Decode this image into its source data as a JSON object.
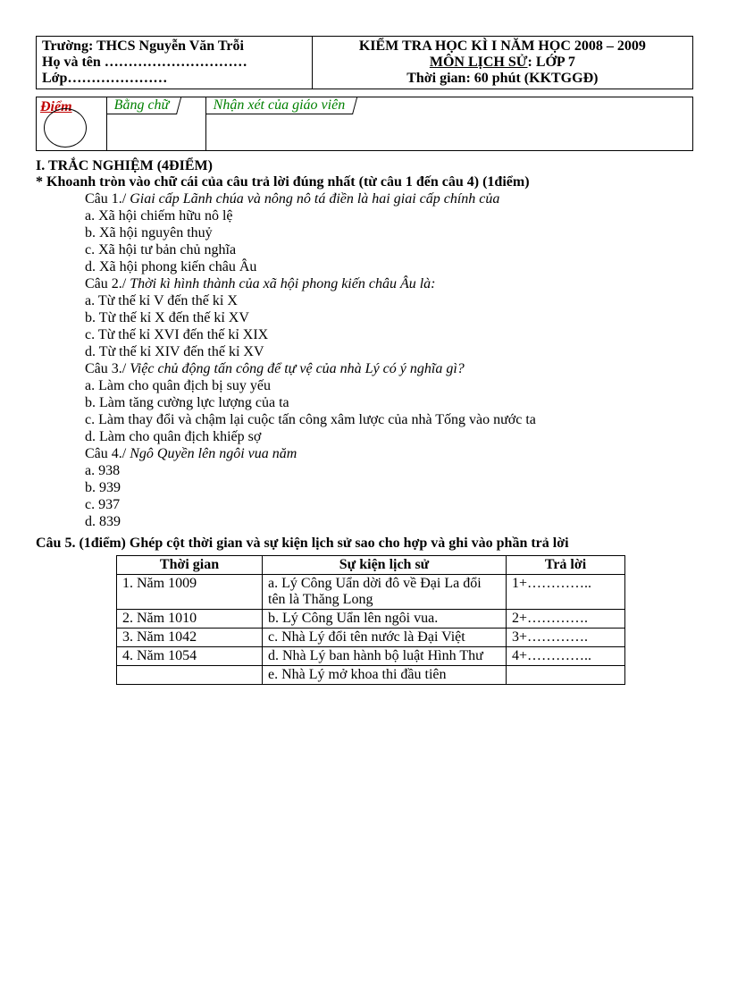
{
  "header": {
    "school": "Trường: THCS Nguyễn Văn Trỗi",
    "name": "Họ và tên …………………………",
    "class": "Lớp…………………",
    "exam_title": "KIỂM TRA HỌC KÌ I NĂM HỌC 2008 – 2009",
    "subject": "MÔN LỊCH SỬ: LỚP 7",
    "subject_label": "MÔN LỊCH SỬ",
    "subject_rest": ": LỚP 7",
    "time": "Thời gian:  60 phút (KKTGGĐ)"
  },
  "grade": {
    "score": "Điểm",
    "words": "Bằng chữ",
    "comment": "Nhận xét của giáo viên"
  },
  "section1": {
    "title": "I. TRẮC NGHIỆM (4ĐIỂM)",
    "instruction": "* Khoanh tròn vào chữ cái của câu trả lời đúng nhất (từ câu 1 đến  câu 4) (1điểm)"
  },
  "q1": {
    "prompt_lead": "Câu 1./ ",
    "prompt": "Giai cấp Lãnh chúa và nông nô tá điền là hai giai cấp chính của",
    "a": "a.   Xã hội chiếm hữu nô lệ",
    "b": "b.   Xã hội nguyên thuỷ",
    "c": "c.   Xã hội tư bản chủ nghĩa",
    "d": "d.   Xã hội phong kiến châu Âu"
  },
  "q2": {
    "prompt_lead": "Câu 2./ ",
    "prompt": "Thời kì hình thành của xã hội phong kiến châu Âu là:",
    "a": "a.   Từ thế kỉ V đến thế kỉ X",
    "b": "b.   Từ thế kỉ X đến thế kỉ XV",
    "c": "c.   Từ thế kỉ XVI đến thế kỉ XIX",
    "d": "d.   Từ thế kỉ XIV đến thế kỉ XV"
  },
  "q3": {
    "prompt_lead": "Câu 3./ ",
    "prompt": "Việc chủ động tấn công để tự vệ của nhà Lý có ý nghĩa gì?",
    "a": "a.   Làm cho quân địch bị suy yếu",
    "b": "b.   Làm tăng cường lực lượng của ta",
    "c": "c.   Làm thay đổi và chậm lại cuộc tấn công xâm lược của nhà Tống vào nước ta",
    "d": "d.   Làm cho quân địch khiếp sợ"
  },
  "q4": {
    "prompt_lead": "Câu 4./ ",
    "prompt": "Ngô Quyền lên ngôi vua năm",
    "a": "a.   938",
    "b": "b.   939",
    "c": "c.   937",
    "d": "d.   839"
  },
  "q5": {
    "title": "Câu 5. (1điểm) Ghép cột thời gian và sự kiện lịch sử sao cho hợp và ghi vào phần trả lời",
    "headers": {
      "time": "Thời gian",
      "event": "Sự kiện lịch sử",
      "answer": "Trả lời"
    },
    "rows": [
      {
        "time": "1. Năm 1009",
        "event": "a. Lý Công Uẩn dời đô về Đại La đổi tên là Thăng Long",
        "answer": "1+………….."
      },
      {
        "time": "2. Năm 1010",
        "event": "b. Lý Công Uẩn lên ngôi vua.",
        "answer": "2+…………."
      },
      {
        "time": "3. Năm 1042",
        "event": "c. Nhà Lý đổi tên nước là Đại Việt",
        "answer": "3+…………."
      },
      {
        "time": "4. Năm 1054",
        "event": "d. Nhà Lý ban hành bộ luật Hình Thư",
        "answer": "4+………….."
      },
      {
        "time": "",
        "event": "e. Nhà Lý mở khoa thi đầu tiên",
        "answer": ""
      }
    ]
  }
}
